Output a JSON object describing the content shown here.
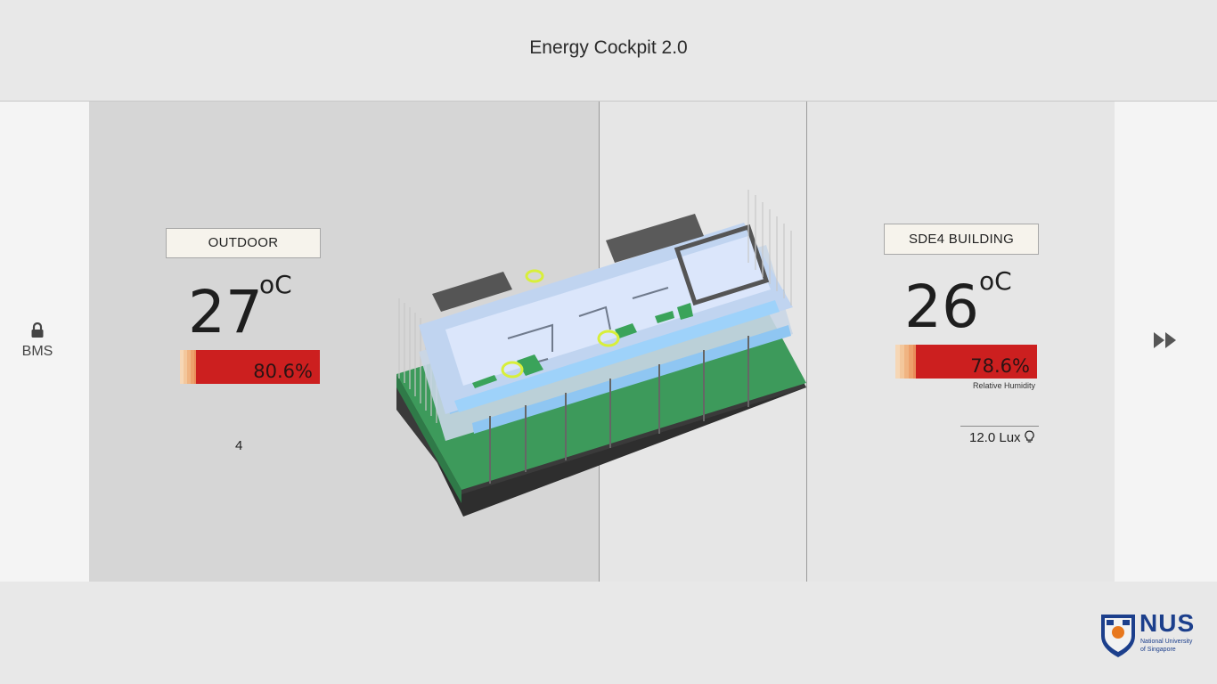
{
  "header": {
    "title": "Energy Cockpit 2.0"
  },
  "left_nav": {
    "bms_label": "BMS",
    "lock_icon": "lock-icon"
  },
  "right_nav": {
    "next_icon": "fast-forward-icon"
  },
  "outdoor": {
    "label": "OUTDOOR",
    "temperature": "27",
    "unit": "oC",
    "humidity_text": "80.6%",
    "humidity_value": 80.6,
    "extra_value": "4"
  },
  "building": {
    "label": "SDE4 BUILDING",
    "temperature": "26",
    "unit": "oC",
    "humidity_text": "78.6%",
    "humidity_value": 78.6,
    "humidity_caption": "Relative Humidity",
    "lux_text": "12.0 Lux",
    "lux_icon": "lightbulb-icon"
  },
  "logo": {
    "wordmark": "NUS",
    "line1": "National University",
    "line2": "of Singapore"
  },
  "colors": {
    "humidity_bar": "#cc1f1f",
    "outdoor_panel": "#d6d6d6",
    "building_panel": "#e6e6e6",
    "nus_blue": "#1c3f8c",
    "nus_orange": "#e8781e"
  }
}
